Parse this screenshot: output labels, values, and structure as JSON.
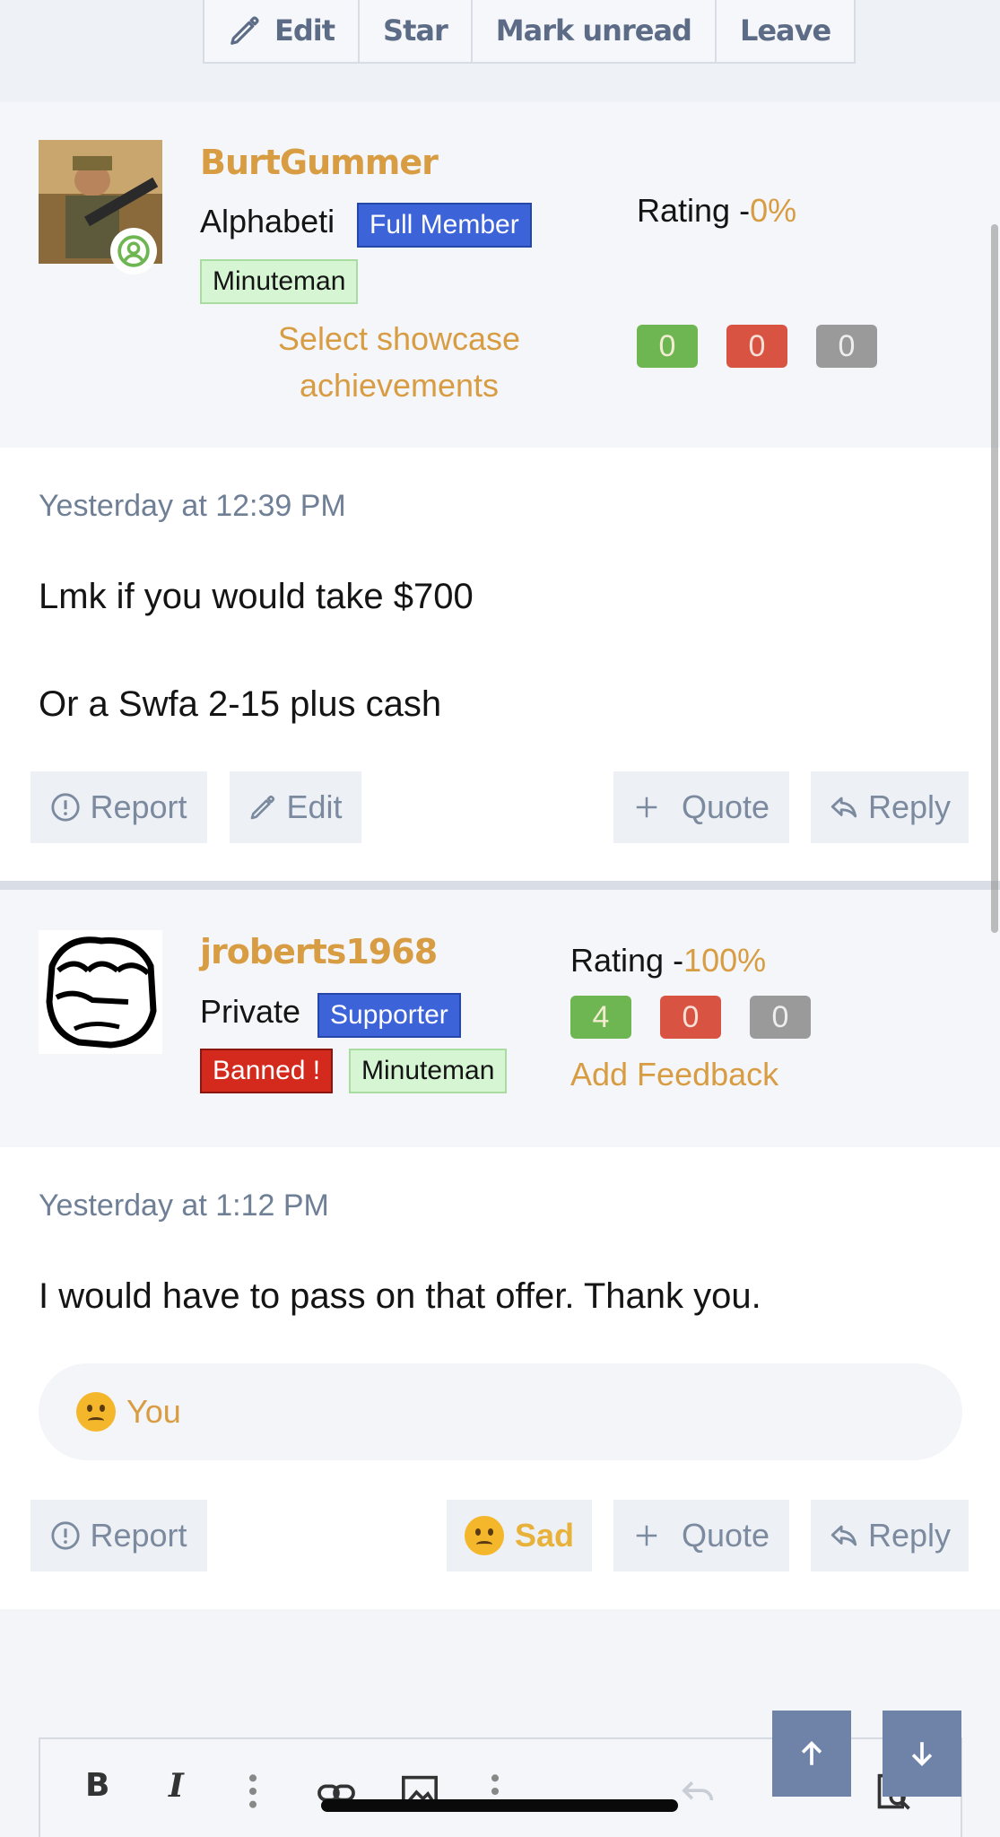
{
  "thread_actions": {
    "edit": "Edit",
    "star": "Star",
    "mark_unread": "Mark unread",
    "leave": "Leave"
  },
  "posts": [
    {
      "username": "BurtGummer",
      "title": "Alphabeti",
      "badges": [
        "Full Member",
        "Minuteman"
      ],
      "showcase_link": "Select showcase achievements",
      "rating_label": "Rating -",
      "rating_value": "0%",
      "counts": [
        "0",
        "0",
        "0"
      ],
      "timestamp": "Yesterday at 12:39 PM",
      "message_lines": [
        "Lmk if you would take $700",
        "Or a Swfa 2-15 plus cash"
      ],
      "actions": {
        "report": "Report",
        "edit": "Edit",
        "quote": "Quote",
        "reply": "Reply"
      }
    },
    {
      "username": "jroberts1968",
      "title": "Private",
      "badges": [
        "Supporter",
        "Banned !",
        "Minuteman"
      ],
      "rating_label": "Rating -",
      "rating_value": "100%",
      "counts": [
        "4",
        "0",
        "0"
      ],
      "feedback_link": "Add Feedback",
      "timestamp": "Yesterday at 1:12 PM",
      "message_lines": [
        "I would have to pass on that offer. Thank you."
      ],
      "reaction_summary": "You",
      "actions": {
        "report": "Report",
        "sad": "Sad",
        "quote": "Quote",
        "reply": "Reply"
      }
    }
  ],
  "editor": {
    "tools": [
      "B",
      "I"
    ]
  },
  "colors": {
    "accent_orange": "#d89c42",
    "badge_blue": "#3d63d9",
    "badge_red": "#d42a1e",
    "chip_green": "#6db651",
    "chip_red": "#d85342",
    "chip_gray": "#9a9a9a",
    "button_text": "#7c8aa0"
  },
  "icons": [
    "pencil-icon",
    "online-status-icon",
    "alert-circle-icon",
    "plus-icon",
    "reply-arrow-icon",
    "sad-face-icon",
    "arrow-up-icon",
    "arrow-down-icon",
    "more-vertical-icon",
    "link-icon",
    "image-icon",
    "undo-icon",
    "preview-icon"
  ]
}
